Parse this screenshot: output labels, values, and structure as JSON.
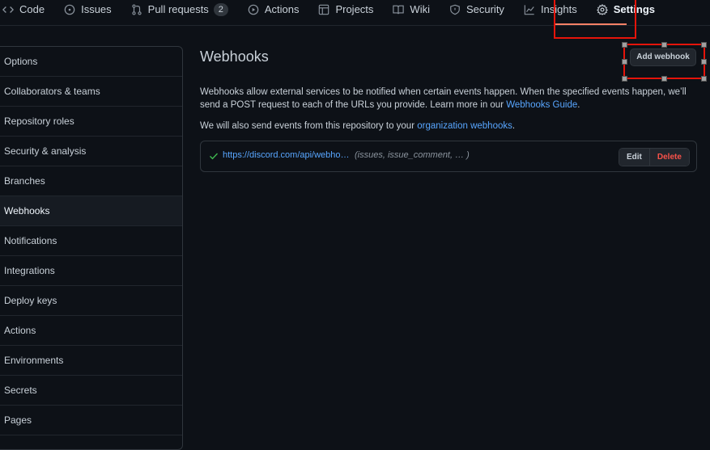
{
  "nav": {
    "tabs": [
      {
        "label": "Code",
        "icon": "code-icon"
      },
      {
        "label": "Issues",
        "icon": "issue-opened-icon"
      },
      {
        "label": "Pull requests",
        "icon": "git-pull-request-icon",
        "count": "2"
      },
      {
        "label": "Actions",
        "icon": "play-icon"
      },
      {
        "label": "Projects",
        "icon": "table-icon"
      },
      {
        "label": "Wiki",
        "icon": "book-icon"
      },
      {
        "label": "Security",
        "icon": "shield-icon"
      },
      {
        "label": "Insights",
        "icon": "graph-icon"
      },
      {
        "label": "Settings",
        "icon": "gear-icon"
      }
    ],
    "active": "Settings"
  },
  "sidebar": {
    "items": [
      {
        "label": "Options"
      },
      {
        "label": "Collaborators & teams"
      },
      {
        "label": "Repository roles"
      },
      {
        "label": "Security & analysis"
      },
      {
        "label": "Branches"
      },
      {
        "label": "Webhooks"
      },
      {
        "label": "Notifications"
      },
      {
        "label": "Integrations"
      },
      {
        "label": "Deploy keys"
      },
      {
        "label": "Actions"
      },
      {
        "label": "Environments"
      },
      {
        "label": "Secrets"
      },
      {
        "label": "Pages"
      }
    ],
    "selected": "Webhooks"
  },
  "main": {
    "title": "Webhooks",
    "add_button": "Add webhook",
    "desc_line1": "Webhooks allow external services to be notified when certain events happen. When the specified events happen, we’ll",
    "desc_line2_pre": "send a POST request to each of the URLs you provide. Learn more in our ",
    "desc_link": "Webhooks Guide",
    "desc_line2_post": ".",
    "org_pre": "We will also send events from this repository to your ",
    "org_link": "organization webhooks",
    "org_post": ".",
    "hook": {
      "url": "https://discord.com/api/webho…",
      "events": "(issues, issue_comment, … )",
      "edit_label": "Edit",
      "delete_label": "Delete"
    }
  },
  "colors": {
    "background": "#0d1117",
    "link": "#58a6ff",
    "danger": "#f85149",
    "success": "#3fb950",
    "active_underline": "#f78166",
    "highlight_box": "#e5140a"
  }
}
